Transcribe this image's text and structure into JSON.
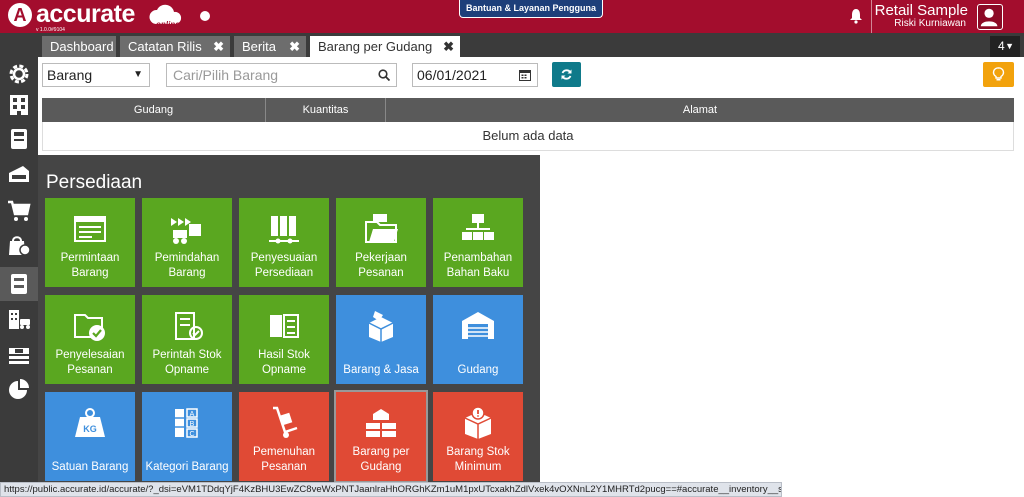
{
  "topbar": {
    "logo_text": "accurate",
    "logo_sub": "online",
    "version": "v 1.0.0#9104",
    "help_label": "Bantuan & Layanan Pengguna",
    "company": "Retail Sample",
    "user": "Riski Kurniawan",
    "brand_color": "#a30d2d"
  },
  "tabs": [
    {
      "label": "Dashboard",
      "closable": false
    },
    {
      "label": "Catatan Rilis",
      "closable": true
    },
    {
      "label": "Berita",
      "closable": true
    },
    {
      "label": "Barang per Gudang",
      "closable": true,
      "active": true
    }
  ],
  "tab_count": "4",
  "sidebar": {
    "icons": [
      "settings-icon",
      "company-icon",
      "ledger-icon",
      "bank-icon",
      "cart-icon",
      "sales-icon",
      "inventory-icon",
      "asset-icon",
      "tax-icon",
      "report-icon"
    ]
  },
  "toolbar": {
    "filter_value": "Barang",
    "search_placeholder": "Cari/Pilih Barang",
    "date_value": "06/01/2021"
  },
  "table": {
    "columns": [
      "Gudang",
      "Kuantitas",
      "Alamat"
    ],
    "empty_text": "Belum ada data"
  },
  "panel": {
    "title": "Persediaan",
    "tiles": [
      {
        "label1": "Permintaan",
        "label2": "Barang",
        "color": "green",
        "icon": "request-icon"
      },
      {
        "label1": "Pemindahan",
        "label2": "Barang",
        "color": "green",
        "icon": "transfer-icon"
      },
      {
        "label1": "Penyesuaian",
        "label2": "Persediaan",
        "color": "green",
        "icon": "adjustment-icon"
      },
      {
        "label1": "Pekerjaan",
        "label2": "Pesanan",
        "color": "green",
        "icon": "folder-icon"
      },
      {
        "label1": "Penambahan",
        "label2": "Bahan Baku",
        "color": "green",
        "icon": "material-icon"
      },
      {
        "label1": "Penyelesaian",
        "label2": "Pesanan",
        "color": "green",
        "icon": "completed-icon"
      },
      {
        "label1": "Perintah Stok",
        "label2": "Opname",
        "color": "green",
        "icon": "stock-order-icon"
      },
      {
        "label1": "Hasil Stok",
        "label2": "Opname",
        "color": "green",
        "icon": "stock-result-icon"
      },
      {
        "label1": "",
        "label2": "Barang & Jasa",
        "color": "blue",
        "icon": "item-icon"
      },
      {
        "label1": "",
        "label2": "Gudang",
        "color": "blue",
        "icon": "warehouse-icon"
      },
      {
        "label1": "",
        "label2": "Satuan Barang",
        "color": "blue",
        "icon": "weight-icon"
      },
      {
        "label1": "",
        "label2": "Kategori Barang",
        "color": "blue",
        "icon": "category-icon"
      },
      {
        "label1": "Pemenuhan",
        "label2": "Pesanan",
        "color": "red",
        "icon": "trolley-icon"
      },
      {
        "label1": "Barang per",
        "label2": "Gudang",
        "color": "red",
        "icon": "boxes-icon",
        "selected": true
      },
      {
        "label1": "Barang Stok",
        "label2": "Minimum",
        "color": "red",
        "icon": "min-stock-icon"
      }
    ]
  },
  "status_url": "https://public.accurate.id/accurate/?_dsi=eVM1TDdqYjF4KzBHU3EwZC8veWxPNTJaanlraHhORGhKZm1uM1pxUTcxakhZdlVxek4vOXNnL2Y1MHRTd2pucg==#accurate__inventory__stock-warehouse"
}
